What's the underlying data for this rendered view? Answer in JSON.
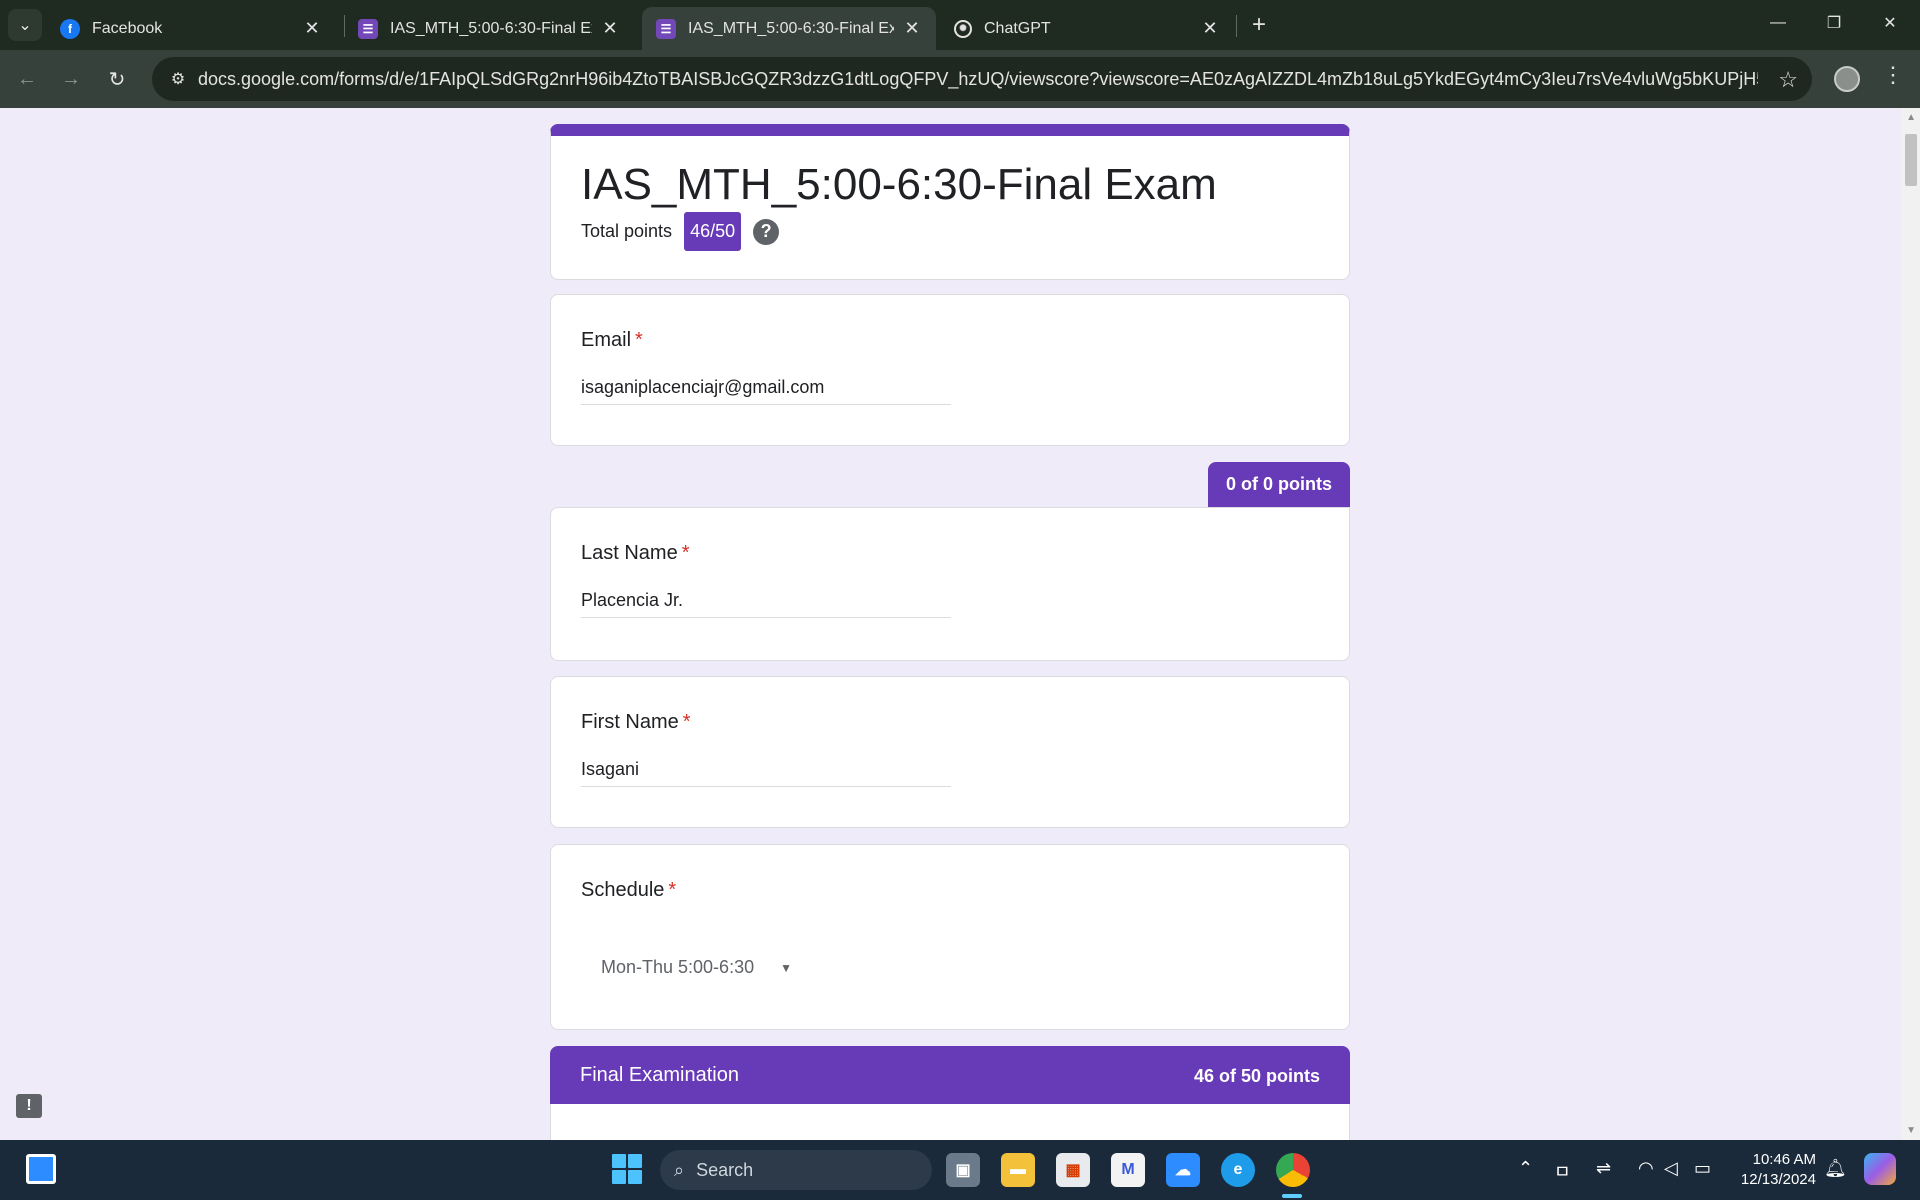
{
  "tabs": [
    {
      "label": "Facebook",
      "icon": "facebook-icon",
      "active": false
    },
    {
      "label": "IAS_MTH_5:00-6:30-Final Exam",
      "icon": "google-forms-icon",
      "active": false
    },
    {
      "label": "IAS_MTH_5:00-6:30-Final Exam",
      "icon": "google-forms-icon",
      "active": true
    },
    {
      "label": "ChatGPT",
      "icon": "chatgpt-icon",
      "active": false
    }
  ],
  "address_bar": {
    "url": "docs.google.com/forms/d/e/1FAIpQLSdGRg2nrH96ib4ZtoTBAISBJcGQZR3dzzG1dtLogQFPV_hzUQ/viewscore?viewscore=AE0zAgAIZZDL4mZb18uLg5YkdEGyt4mCy3Ieu7rsVe4vluWg5bKUPjH5Klz5zr6hV..."
  },
  "form": {
    "title": "IAS_MTH_5:00-6:30-Final Exam",
    "total_points_label": "Total points",
    "total_points_value": "46/50",
    "help_glyph": "?"
  },
  "questions": {
    "email": {
      "label": "Email",
      "required_mark": "*",
      "answer": "isaganiplacenciajr@gmail.com"
    },
    "section_points": "0 of 0 points",
    "last_name": {
      "label": "Last Name",
      "required_mark": "*",
      "answer": "Placencia Jr."
    },
    "first_name": {
      "label": "First Name",
      "required_mark": "*",
      "answer": "Isagani"
    },
    "schedule": {
      "label": "Schedule",
      "required_mark": "*",
      "selected": "Mon-Thu 5:00-6:30"
    }
  },
  "section": {
    "title": "Final Examination",
    "points": "46 of 50 points"
  },
  "taskbar": {
    "search_placeholder": "Search",
    "time": "10:46 AM",
    "date": "12/13/2024"
  },
  "colors": {
    "accent": "#673ab7",
    "page_bg": "#f0ebf8",
    "required": "#d93025"
  }
}
